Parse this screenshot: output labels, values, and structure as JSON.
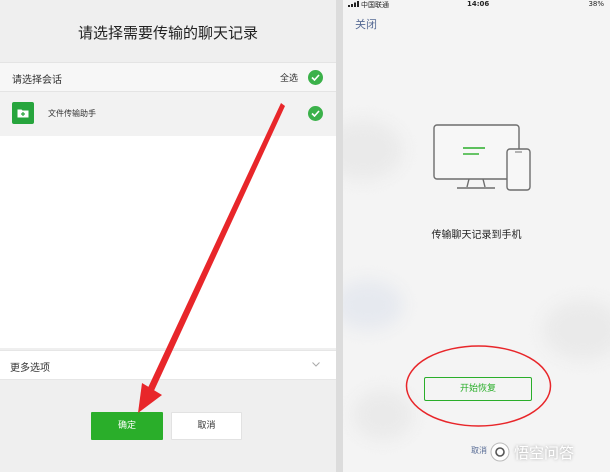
{
  "left": {
    "title": "请选择需要传输的聊天记录",
    "section_label": "请选择会话",
    "select_all": "全选",
    "chats": [
      {
        "name": "文件传输助手",
        "icon": "folder-icon",
        "selected": true
      }
    ],
    "more_options": "更多选项",
    "confirm_label": "确定",
    "cancel_label": "取消"
  },
  "right": {
    "status_bar": {
      "carrier": "中国联通",
      "time": "14:06",
      "battery": "38%"
    },
    "close_label": "关闭",
    "transfer_text": "传输聊天记录到手机",
    "start_label": "开始恢复",
    "cancel_label": "取消"
  },
  "watermark": "悟空问答",
  "colors": {
    "wechat_green": "#2aae2a",
    "link_blue": "#576b95",
    "annotation_red": "#e8262a"
  }
}
